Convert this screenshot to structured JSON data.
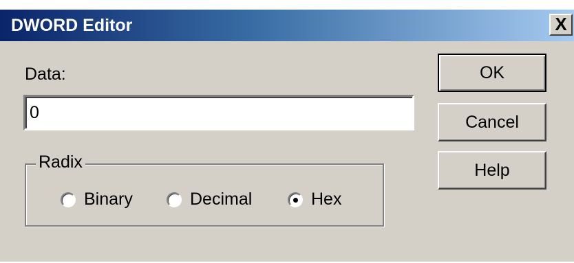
{
  "window": {
    "title": "DWORD Editor",
    "close_glyph": "X"
  },
  "data_field": {
    "label": "Data:",
    "value": "0"
  },
  "radix": {
    "legend": "Radix",
    "options": [
      {
        "label": "Binary",
        "selected": false
      },
      {
        "label": "Decimal",
        "selected": false
      },
      {
        "label": "Hex",
        "selected": true
      }
    ]
  },
  "buttons": {
    "ok": "OK",
    "cancel": "Cancel",
    "help": "Help"
  },
  "colors": {
    "face": "#d4d0c8",
    "titlebar_start": "#0a246a",
    "titlebar_end": "#a6caf0"
  }
}
